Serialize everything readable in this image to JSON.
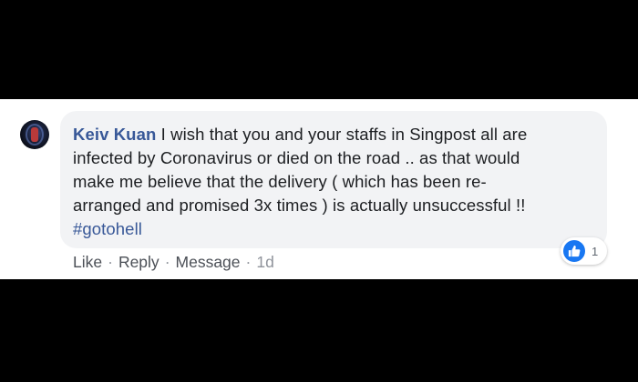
{
  "comment": {
    "author": "Keiv Kuan",
    "lines": [
      "I wish that you and your staffs in Singpost all are",
      "infected by Coronavirus or died on the road .. as that would",
      "make me believe that the delivery ( which has been re-",
      "arranged and promised 3x times ) is actually unsuccessful !!"
    ],
    "hashtag": "#gotohell",
    "reaction_count": "1"
  },
  "actions": {
    "like_label": "Like",
    "reply_label": "Reply",
    "message_label": "Message",
    "separator": "·",
    "timestamp": "1d"
  },
  "colors": {
    "author_link": "#385898",
    "bubble_bg": "#f2f3f5",
    "like_blue": "#1877f2",
    "meta_gray": "#606770"
  },
  "icons": {
    "reaction": "like-thumbs-up-icon",
    "avatar": "user-avatar"
  }
}
